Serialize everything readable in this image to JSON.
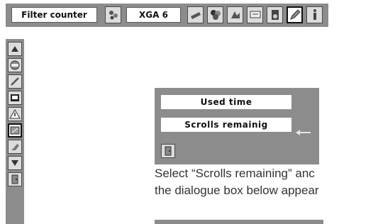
{
  "menu": {
    "title": "Filter counter",
    "input_mode": "XGA 6",
    "icons": [
      "sound-icon",
      "projector-icon",
      "color-palette-icon",
      "image-adjust-icon",
      "display-screen-icon",
      "speaker-icon",
      "pen-setting-icon",
      "info-icon"
    ]
  },
  "sidebar": {
    "icons": [
      "up-arrow-icon",
      "reset-icon",
      "wrench-icon",
      "screen-icon",
      "warning-icon",
      "filter-icon",
      "filter-counter-icon",
      "down-arrow-icon",
      "exit-icon"
    ]
  },
  "dialog": {
    "used_time_label": "Used time",
    "scrolls_label": "Scrolls remainig"
  },
  "instructions": {
    "line1": "Select “Scrolls remaining” anc",
    "line2": "the dialogue box below appear"
  }
}
